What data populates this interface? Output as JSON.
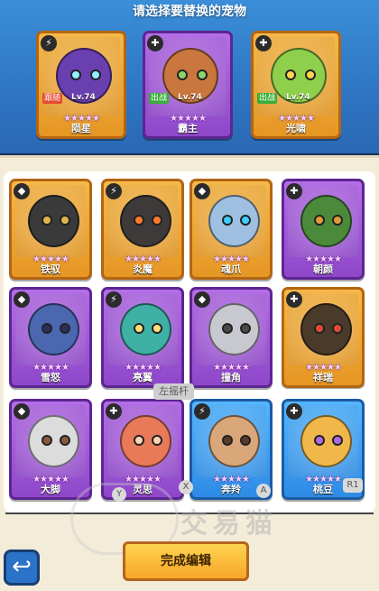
{
  "header": {
    "title": "请选择要替换的宠物"
  },
  "team": [
    {
      "name": "陨星",
      "level": "Lv.74",
      "tag": "跟随",
      "tag_color": "red",
      "stars": "★★★★★",
      "badge": "⚡",
      "frame": "gold",
      "body_color": "#6a3fb0",
      "accent": "#8ff0ff"
    },
    {
      "name": "霸主",
      "level": "Lv.74",
      "tag": "出战",
      "tag_color": "green",
      "stars": "★★★★★",
      "badge": "✚",
      "frame": "purple",
      "body_color": "#c9763f",
      "accent": "#8fd36a"
    },
    {
      "name": "光啸",
      "level": "Lv.74",
      "tag": "出战",
      "tag_color": "green",
      "stars": "★★★★★",
      "badge": "✚",
      "frame": "gold",
      "body_color": "#8ed04b",
      "accent": "#ffd44f"
    }
  ],
  "pets": [
    {
      "name": "铁驭",
      "stars": "★★★★★",
      "badge": "◆",
      "frame": "gold",
      "body_color": "#3a3a3a",
      "accent": "#e2b54a"
    },
    {
      "name": "炎魔",
      "stars": "★★★★★",
      "badge": "⚡",
      "frame": "gold",
      "body_color": "#3f3a3a",
      "accent": "#ff7a2a"
    },
    {
      "name": "魂爪",
      "stars": "★★★★★",
      "badge": "◆",
      "frame": "gold",
      "body_color": "#9fc0e0",
      "accent": "#3ed0ff"
    },
    {
      "name": "朝颜",
      "stars": "★★★★★",
      "badge": "✚",
      "frame": "purple",
      "body_color": "#4a8a3a",
      "accent": "#e09a3a"
    },
    {
      "name": "雪怒",
      "stars": "★★★★★",
      "badge": "◆",
      "frame": "purple",
      "body_color": "#4b67b0",
      "accent": "#2b2f5a"
    },
    {
      "name": "亮翼",
      "stars": "★★★★★",
      "badge": "⚡",
      "frame": "purple",
      "body_color": "#3fb0a6",
      "accent": "#ffe07a"
    },
    {
      "name": "撞角",
      "stars": "★★★★★",
      "badge": "◆",
      "frame": "purple",
      "body_color": "#c8c8d0",
      "accent": "#4a4a4a"
    },
    {
      "name": "祥瑞",
      "stars": "★★★★★",
      "badge": "✚",
      "frame": "gold",
      "body_color": "#4a3a2a",
      "accent": "#e24a32"
    },
    {
      "name": "大脚",
      "stars": "★★★★★",
      "badge": "◆",
      "frame": "purple",
      "body_color": "#dcdcdc",
      "accent": "#8a5a3a"
    },
    {
      "name": "灵思",
      "stars": "★★★★★",
      "badge": "✚",
      "frame": "purple",
      "body_color": "#e87a5a",
      "accent": "#ffd2b0"
    },
    {
      "name": "奔羚",
      "stars": "★★★★★",
      "badge": "⚡",
      "frame": "blue",
      "body_color": "#d9a77a",
      "accent": "#5a3a2a"
    },
    {
      "name": "桃豆",
      "stars": "★★★★★",
      "badge": "✚",
      "frame": "blue",
      "body_color": "#f0b84a",
      "accent": "#b06ae0"
    }
  ],
  "hints": {
    "left_stick": "左摇杆",
    "y_key": "Y",
    "x_key": "X",
    "a_key": "A",
    "r1_key": "R1"
  },
  "actions": {
    "complete": "完成编辑",
    "back_icon": "↩"
  },
  "watermark": "交易猫"
}
